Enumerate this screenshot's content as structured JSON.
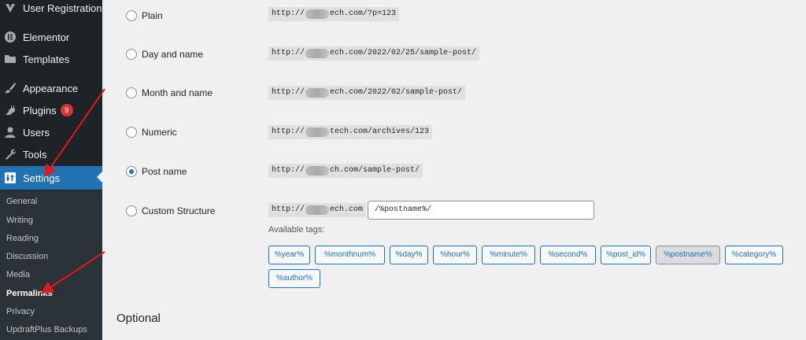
{
  "sidebar": {
    "items": [
      {
        "label": "User Registration",
        "icon": "user-registration-icon"
      },
      {
        "label": "Elementor",
        "icon": "elementor-icon"
      },
      {
        "label": "Templates",
        "icon": "folder-icon"
      },
      {
        "label": "Appearance",
        "icon": "paintbrush-icon"
      },
      {
        "label": "Plugins",
        "icon": "plug-icon",
        "badge": "9"
      },
      {
        "label": "Users",
        "icon": "user-icon"
      },
      {
        "label": "Tools",
        "icon": "wrench-icon"
      },
      {
        "label": "Settings",
        "icon": "settings-icon",
        "active": true
      }
    ],
    "submenu": [
      {
        "label": "General"
      },
      {
        "label": "Writing"
      },
      {
        "label": "Reading"
      },
      {
        "label": "Discussion"
      },
      {
        "label": "Media"
      },
      {
        "label": "Permalinks",
        "current": true
      },
      {
        "label": "Privacy"
      },
      {
        "label": "UpdraftPlus Backups"
      }
    ]
  },
  "permalinks": {
    "options": [
      {
        "label": "Plain",
        "prefix": "http://",
        "suffix": "ech.com/?p=123",
        "checked": false
      },
      {
        "label": "Day and name",
        "prefix": "http://",
        "suffix": "ech.com/2022/02/25/sample-post/",
        "checked": false
      },
      {
        "label": "Month and name",
        "prefix": "http://",
        "suffix": "ech.com/2022/02/sample-post/",
        "checked": false
      },
      {
        "label": "Numeric",
        "prefix": "http://",
        "suffix": "tech.com/archives/123",
        "checked": false
      },
      {
        "label": "Post name",
        "prefix": "http://",
        "suffix": "ch.com/sample-post/",
        "checked": true
      },
      {
        "label": "Custom Structure",
        "prefix": "http://",
        "suffix": "ech.com",
        "checked": false
      }
    ],
    "custom_structure_value": "/%postname%/",
    "available_tags_label": "Available tags:",
    "tags": [
      "%year%",
      "%monthnum%",
      "%day%",
      "%hour%",
      "%minute%",
      "%second%",
      "%post_id%",
      "%postname%",
      "%category%",
      "%author%"
    ],
    "pressed_tag": "%postname%"
  },
  "optional": {
    "title": "Optional"
  },
  "colors": {
    "sidebar_bg": "#1d2327",
    "accent": "#2271b1",
    "badge": "#d63638",
    "arrow": "#e0191b"
  }
}
